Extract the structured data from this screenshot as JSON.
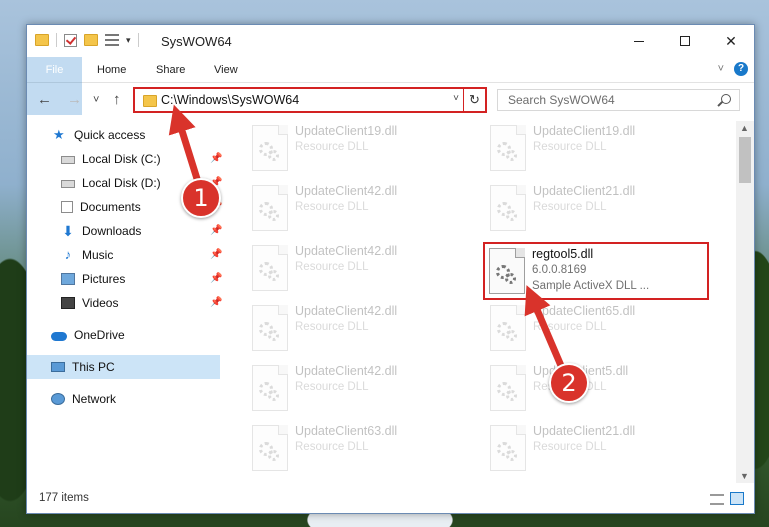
{
  "window": {
    "title": "SysWOW64"
  },
  "titlebar_icons": [
    "folder-icon",
    "checkmark-icon",
    "folder-icon",
    "properties-icon"
  ],
  "ribbon": {
    "tabs": [
      {
        "label": "File"
      },
      {
        "label": "Home"
      },
      {
        "label": "Share"
      },
      {
        "label": "View"
      }
    ],
    "help": "?"
  },
  "nav": {
    "back": "←",
    "forward": "→",
    "recent": "˅",
    "up": "↑"
  },
  "address": {
    "path": "C:\\Windows\\SysWOW64",
    "dropdown": "˅",
    "refresh": "↻"
  },
  "search": {
    "placeholder": "Search SysWOW64"
  },
  "sidebar": {
    "items": [
      {
        "label": "Quick access",
        "icon": "star-icon"
      },
      {
        "label": "Local Disk (C:)",
        "icon": "drive-icon",
        "pinned": true
      },
      {
        "label": "Local Disk (D:)",
        "icon": "drive-icon",
        "pinned": true
      },
      {
        "label": "Documents",
        "icon": "documents-icon",
        "pinned": true
      },
      {
        "label": "Downloads",
        "icon": "downloads-icon",
        "pinned": true
      },
      {
        "label": "Music",
        "icon": "music-icon",
        "pinned": true
      },
      {
        "label": "Pictures",
        "icon": "pictures-icon",
        "pinned": true
      },
      {
        "label": "Videos",
        "icon": "videos-icon",
        "pinned": true
      },
      {
        "label": "OneDrive",
        "icon": "onedrive-icon"
      },
      {
        "label": "This PC",
        "icon": "this-pc-icon",
        "selected": true
      },
      {
        "label": "Network",
        "icon": "network-icon"
      }
    ]
  },
  "files": [
    {
      "name": "UpdateClient19.dll",
      "line1": "Resource DLL",
      "line2": ""
    },
    {
      "name": "UpdateClient19.dll",
      "line1": "Resource DLL",
      "line2": ""
    },
    {
      "name": "UpdateClient42.dll",
      "line1": "Resource DLL",
      "line2": ""
    },
    {
      "name": "UpdateClient21.dll",
      "line1": "Resource DLL",
      "line2": ""
    },
    {
      "name": "UpdateClient42.dll",
      "line1": "Resource DLL",
      "line2": ""
    },
    {
      "name": "regtool5.dll",
      "line1": "6.0.0.8169",
      "line2": "Sample ActiveX DLL ...",
      "highlighted": true
    },
    {
      "name": "UpdateClient42.dll",
      "line1": "Resource DLL",
      "line2": ""
    },
    {
      "name": "UpdateClient65.dll",
      "line1": "Resource DLL",
      "line2": ""
    },
    {
      "name": "UpdateClient42.dll",
      "line1": "Resource DLL",
      "line2": ""
    },
    {
      "name": "UpdateClient5.dll",
      "line1": "Resource DLL",
      "line2": ""
    },
    {
      "name": "UpdateClient63.dll",
      "line1": "Resource DLL",
      "line2": ""
    },
    {
      "name": "UpdateClient21.dll",
      "line1": "Resource DLL",
      "line2": ""
    }
  ],
  "status": {
    "item_count": "177 items"
  },
  "annotations": {
    "step1": "1",
    "step2": "2",
    "accent": "#d9332b"
  }
}
